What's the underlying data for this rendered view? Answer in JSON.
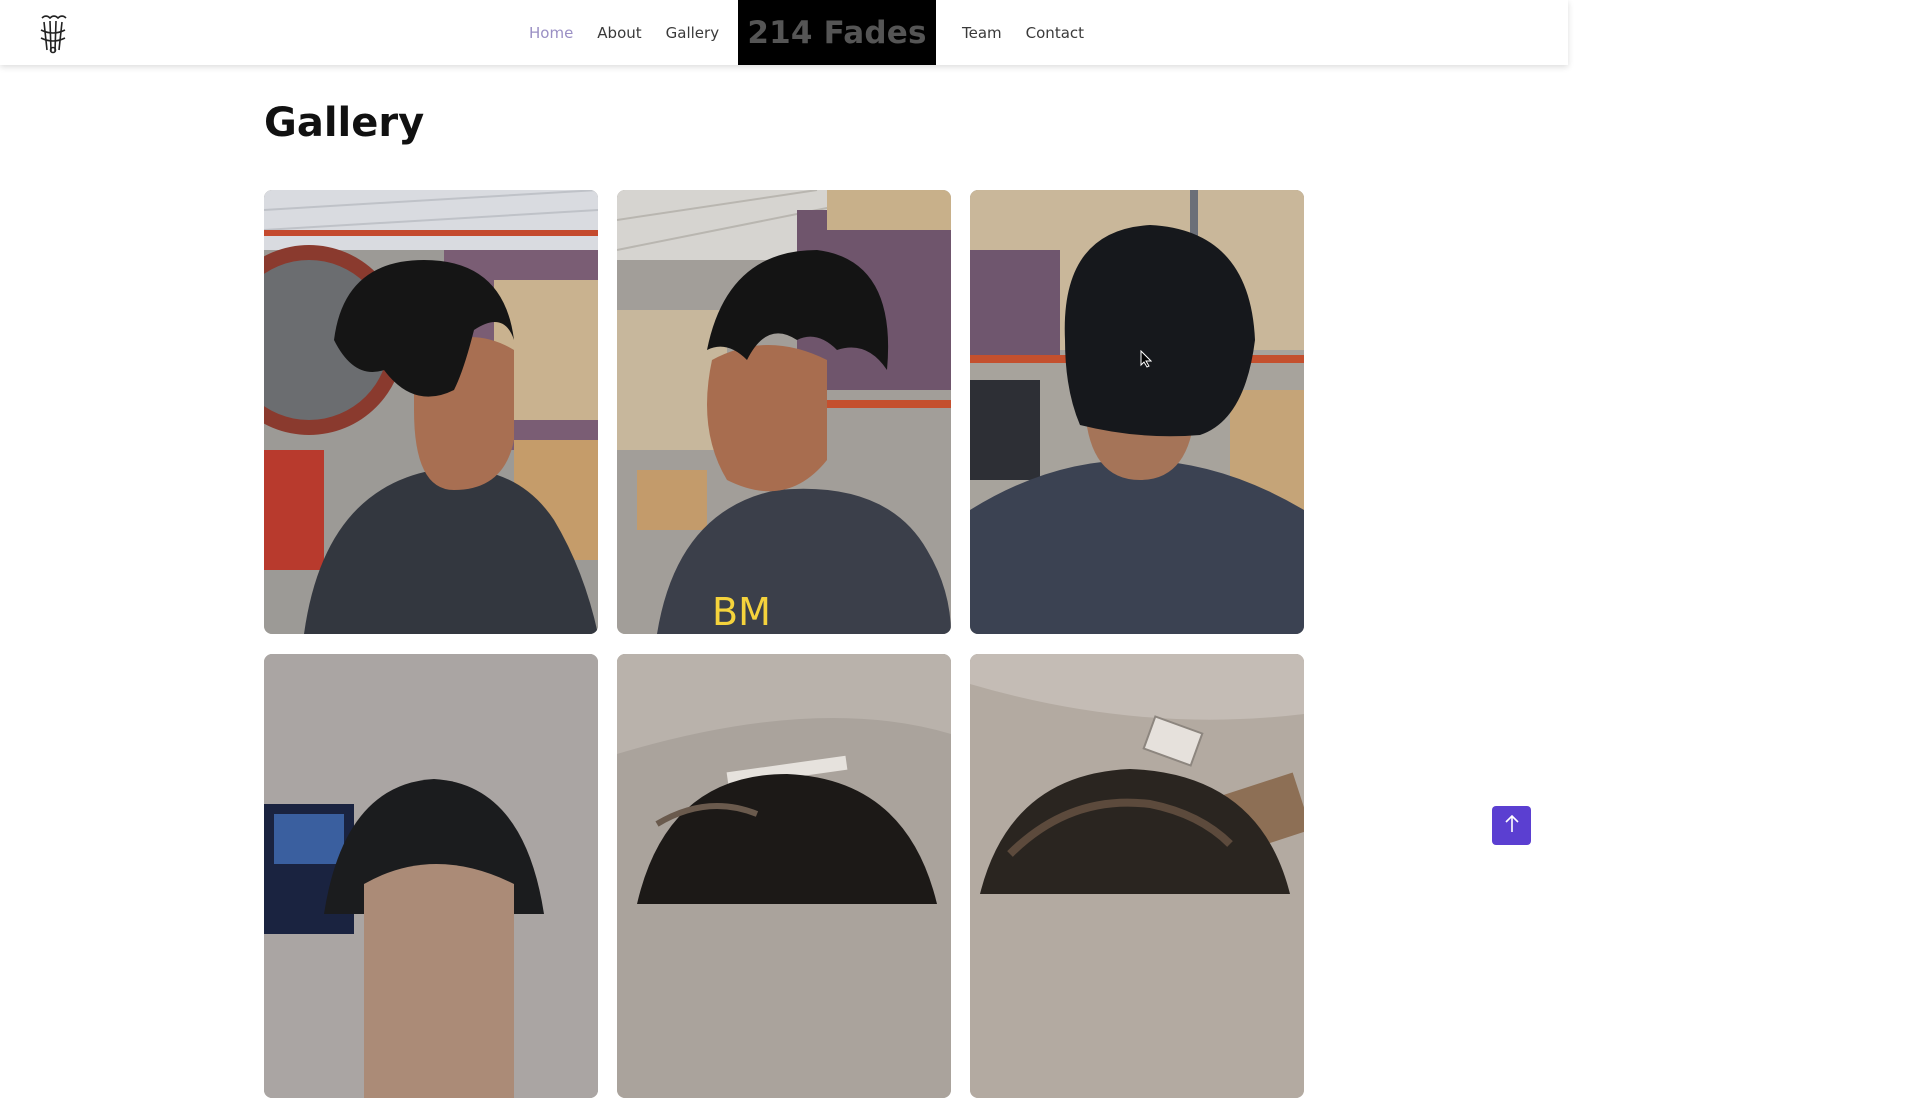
{
  "header": {
    "logo_icon": "barbershop-logo-icon",
    "brand": "214 Fades",
    "nav_left": [
      {
        "label": "Home",
        "active": true
      },
      {
        "label": "About",
        "active": false
      },
      {
        "label": "Gallery",
        "active": false
      }
    ],
    "nav_right": [
      {
        "label": "Team",
        "active": false
      },
      {
        "label": "Contact",
        "active": false
      }
    ],
    "colors": {
      "active_link": "#9a8fc4",
      "brand_bg": "#000000",
      "brand_text": "#555555"
    }
  },
  "main": {
    "title": "Gallery",
    "photos": [
      {
        "subject": "haircut-side-profile-right",
        "setting": "warehouse"
      },
      {
        "subject": "haircut-side-profile-left",
        "setting": "warehouse"
      },
      {
        "subject": "haircut-back-view",
        "setting": "warehouse"
      },
      {
        "subject": "haircut-top-view",
        "setting": "room"
      },
      {
        "subject": "haircut-top-view",
        "setting": "room"
      },
      {
        "subject": "haircut-top-view",
        "setting": "room"
      }
    ]
  },
  "scroll_top": {
    "icon": "arrow-up-icon",
    "color": "#5b3fd1"
  }
}
